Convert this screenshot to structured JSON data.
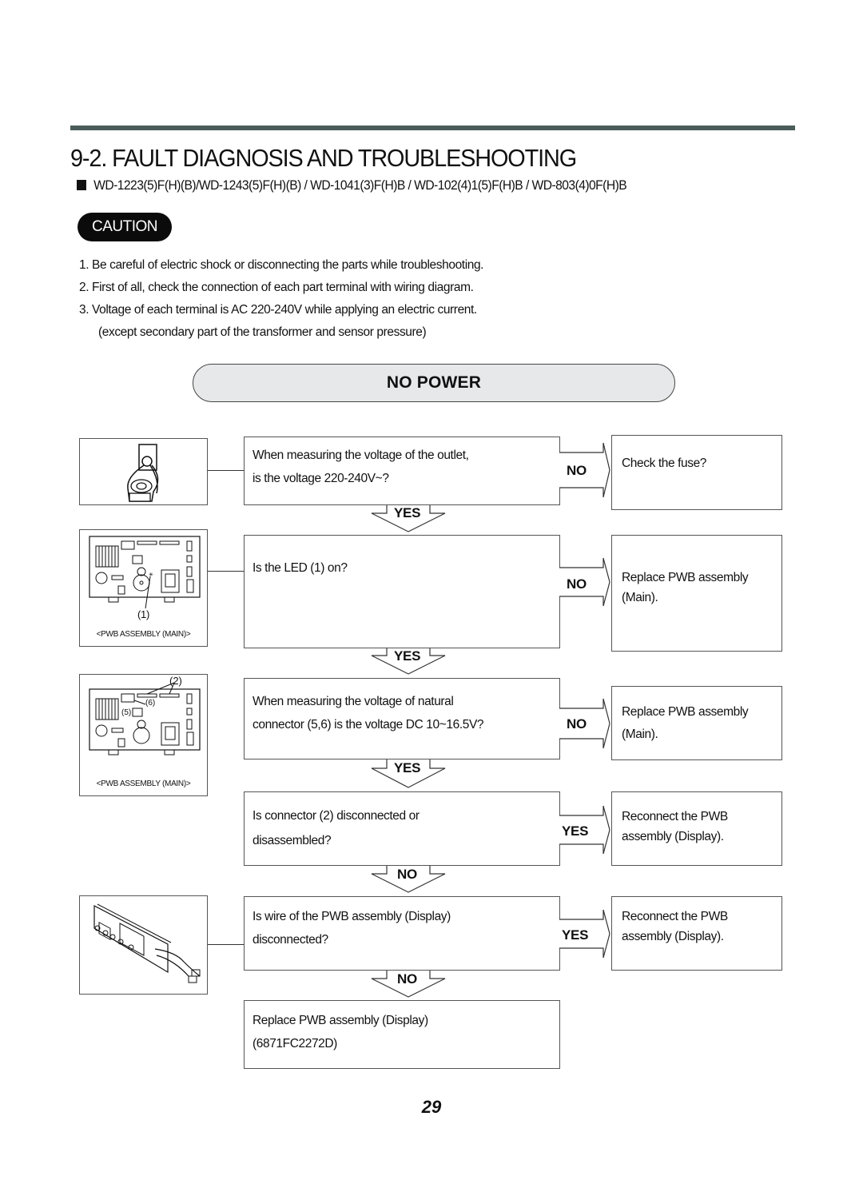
{
  "header": {
    "title": "9-2. FAULT DIAGNOSIS AND TROUBLESHOOTING",
    "models": "WD-1223(5)F(H)(B)/WD-1243(5)F(H)(B) / WD-1041(3)F(H)B / WD-102(4)1(5)F(H)B / WD-803(4)0F(H)B",
    "bullet_icon": "square-bullet"
  },
  "caution": {
    "label": "CAUTION",
    "notes": [
      "1. Be careful of electric shock or disconnecting the parts while troubleshooting.",
      "2. First of all, check the connection of each part terminal with wiring diagram.",
      "3. Voltage of each terminal is AC 220-240V while applying an electric current.",
      "(except secondary part of the transformer and sensor pressure)"
    ]
  },
  "section": {
    "title": "NO POWER"
  },
  "images": {
    "outlet": {
      "icon": "outlet-plug-icon"
    },
    "pwb_main_1": {
      "callout": "(1)",
      "caption": "<PWB ASSEMBLY (MAIN)>"
    },
    "pwb_main_2": {
      "callout_2": "(2)",
      "callout_5": "(5)",
      "callout_6": "(6)",
      "caption": "<PWB ASSEMBLY (MAIN)>"
    },
    "pwb_display": {
      "icon": "display-pwb-icon"
    }
  },
  "flow": {
    "steps": [
      {
        "question": [
          "When measuring the voltage of the outlet,",
          "is the voltage 220-240V~?"
        ],
        "side_label": "NO",
        "side_action": [
          "Check the fuse?"
        ],
        "down_label": "YES"
      },
      {
        "question": [
          "Is the LED (1) on?"
        ],
        "side_label": "NO",
        "side_action": [
          "Replace PWB assembly",
          "(Main)."
        ],
        "down_label": "YES"
      },
      {
        "question": [
          "When measuring the voltage of natural",
          "connector (5,6) is the voltage DC 10~16.5V?"
        ],
        "side_label": "NO",
        "side_action": [
          "Replace PWB assembly",
          "(Main)."
        ],
        "down_label": "YES"
      },
      {
        "question": [
          "Is connector (2)  disconnected or",
          "disassembled?"
        ],
        "side_label": "YES",
        "side_action": [
          "Reconnect the PWB",
          "assembly (Display)."
        ],
        "down_label": "NO"
      },
      {
        "question": [
          "Is wire of the PWB assembly (Display)",
          "disconnected?"
        ],
        "side_label": "YES",
        "side_action": [
          "Reconnect the PWB",
          "assembly  (Display)."
        ],
        "down_label": "NO"
      }
    ],
    "final": [
      "Replace PWB assembly (Display)",
      "(6871FC2272D)"
    ]
  },
  "footer": {
    "page_number": "29"
  }
}
